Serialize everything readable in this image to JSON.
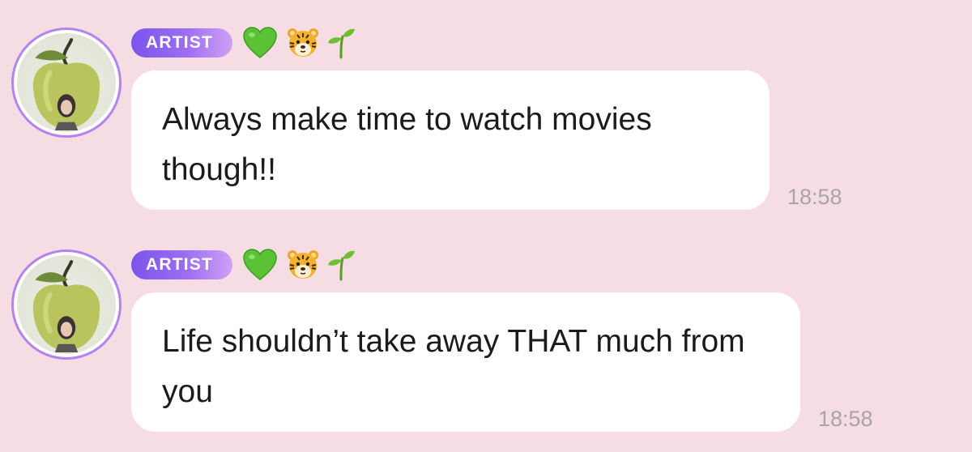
{
  "messages": [
    {
      "sender_badge": "ARTIST",
      "badge_icons": [
        "green-heart-icon",
        "tiger-face-icon",
        "seedling-icon"
      ],
      "avatar": "green-apple-avatar",
      "text": "Always make time to watch movies though!!",
      "time": "18:58"
    },
    {
      "sender_badge": "ARTIST",
      "badge_icons": [
        "green-heart-icon",
        "tiger-face-icon",
        "seedling-icon"
      ],
      "avatar": "green-apple-avatar",
      "text": "Life shouldn’t take away THAT much from you",
      "time": "18:58"
    }
  ],
  "colors": {
    "background": "#f6dde3",
    "bubble": "#ffffff",
    "badge_gradient_start": "#7a54ec",
    "badge_gradient_end": "#cfa0f6",
    "avatar_ring": "#b383ee",
    "timestamp": "#a9a4a6"
  }
}
